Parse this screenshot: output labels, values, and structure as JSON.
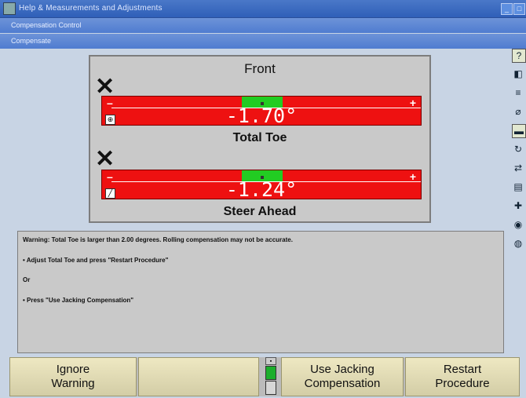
{
  "window": {
    "title": "Help & Measurements and Adjustments",
    "sub1": "Compensation Control",
    "sub2": "Compensate"
  },
  "gauges": {
    "axle": "Front",
    "total_toe": {
      "value": "-1.70°",
      "label": "Total Toe",
      "status": "out-of-spec"
    },
    "steer_ahead": {
      "value": "-1.24°",
      "label": "Steer Ahead",
      "status": "out-of-spec"
    },
    "minus_symbol": "–",
    "plus_symbol": "+",
    "x_symbol": "✕",
    "colors": {
      "bar": "#ee1111",
      "in_spec": "#22cc22"
    }
  },
  "message": {
    "warning": "Warning:  Total Toe is larger than 2.00 degrees.  Rolling compensation may not be accurate.",
    "step1": "•     Adjust Total Toe and press \"Restart Procedure\"",
    "or": "Or",
    "step2": "•     Press \"Use Jacking Compensation\""
  },
  "buttons": {
    "b1_line1": "Ignore",
    "b1_line2": "Warning",
    "b3_line1": "Use Jacking",
    "b3_line2": "Compensation",
    "b4_line1": "Restart",
    "b4_line2": "Procedure"
  },
  "toolbar_icons": [
    "help-icon",
    "vehicle-specs-icon",
    "measure-icon",
    "caster-icon",
    "gauge-icon",
    "rotate-icon",
    "alignment-icon",
    "printer-icon",
    "tools-icon",
    "camera-icon",
    "globe-icon"
  ]
}
